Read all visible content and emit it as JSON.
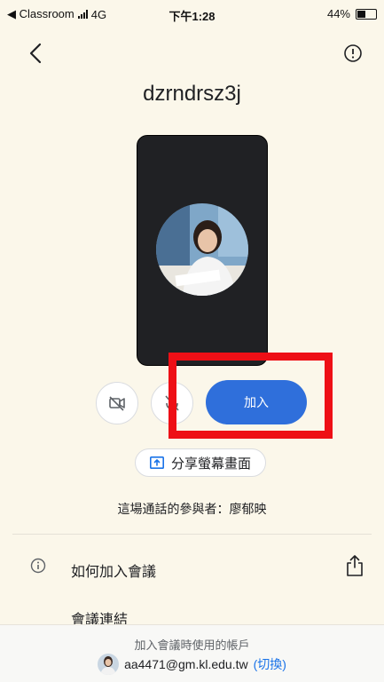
{
  "status_bar": {
    "carrier": "◀ Classroom",
    "network": "4G",
    "time": "下午1:28",
    "battery": "44%"
  },
  "meeting": {
    "code": "dzrndrsz3j"
  },
  "controls": {
    "join_label": "加入",
    "share_screen_label": "分享螢幕畫面"
  },
  "participants_text": "這場通話的參與者：廖郁映",
  "menu": {
    "how_to_join": "如何加入會議",
    "meeting_link": "會議連結"
  },
  "account": {
    "caption": "加入會議時使用的帳戶",
    "email": "aa4471@gm.kl.edu.tw",
    "switch_open": "(",
    "switch_label": "切換",
    "switch_close": ")"
  },
  "colors": {
    "accent": "#2f6fdb",
    "highlight": "#ee0f16",
    "background": "#fbf7ea"
  }
}
